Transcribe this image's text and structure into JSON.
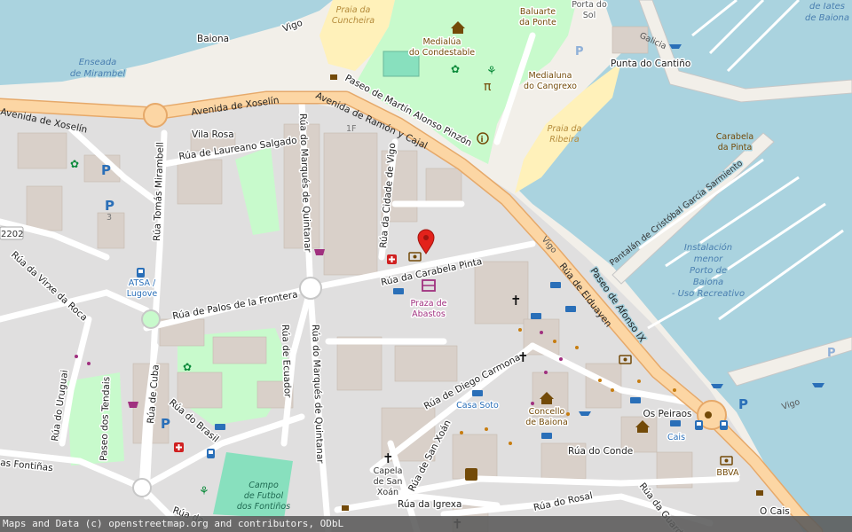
{
  "attribution": "Maps and Data (c) openstreetmap.org and contributors, ODbL",
  "colors": {
    "water": "#aad3df",
    "land": "#f2efe9",
    "residential": "#e0dfdf",
    "park": "#c8facc",
    "pitch": "#88e0be",
    "beach": "#fff1ba",
    "primary_road": "#fcd6a4",
    "primary_casing": "#e6a96a",
    "building": "#d9d0c9",
    "marker": "#e3221b"
  },
  "labels": {
    "baiona_top": "Baiona",
    "vigo_top": "Vigo",
    "enseada": [
      "Enseada",
      "de Mirambel"
    ],
    "praia_cuncheira": [
      "Praia da",
      "Cuncheira"
    ],
    "medialua_condestable": [
      "Medialúa",
      "do Condestable"
    ],
    "baluarte": [
      "Baluarte",
      "da Ponte"
    ],
    "porta_sol": [
      "Porta do",
      "Sol"
    ],
    "iate": [
      "de Iates",
      "de Baiona"
    ],
    "galicia": "Galicia",
    "punta_cantino": "Punta do Cantiño",
    "medialuna_cangrexo": [
      "Medialuna",
      "do Cangrexo"
    ],
    "praia_ribeira": [
      "Praia da",
      "Ribeira"
    ],
    "carabela_pinta_boat": [
      "Carabela",
      "da Pinta"
    ],
    "pantalan": "Pantalán de Cristóbal García Sarmiento",
    "instalacion": [
      "Instalación",
      "menor",
      "Porto de",
      "Baiona",
      "- Uso Recreativo"
    ],
    "avenida_xoselin_left": "Avenida de Xoselín",
    "avenida_xoselin": "Avenida de Xoselín",
    "avenida_ramon": "Avenida de Ramón y Cajal",
    "paseo_martin": "Paseo de Martín Alonso Pinzón",
    "vila_rosa": "Vila Rosa",
    "rua_laureano": "Rúa de Laureano Salgado",
    "rua_tomas": "Rúa Tomás Mirambell",
    "rua_marques_quintanar": "Rúa do Marqués de Quintanar",
    "rua_cidade_vigo": "Rúa da Cidade de Vigo",
    "label_1f": "1F",
    "label_3": "3",
    "road_ref": "2202",
    "rua_virxe": "Rúa da Virxe da Roca",
    "atsa": [
      "ATSA /",
      "Lugove"
    ],
    "rua_palos": "Rúa de Palos de la Frontera",
    "rua_carabela": "Rúa da Carabela Pinta",
    "praza_abastos": [
      "Praza de",
      "Abastos"
    ],
    "vigo_right": "Vigo",
    "rua_elduayen": "Rúa de Elduayen",
    "paseo_afonso": "Paseo de Afonso IX",
    "rua_ecuador": "Rúa de Ecuador",
    "rua_marques_quintanar_2": "Rúa do Marqués de Quintanar",
    "rua_uruguai": "Rúa do Uruguai",
    "paseo_tendais": "Paseo dos Tendais",
    "rua_cuba": "Rúa de Cuba",
    "rua_brasil": "Rúa do Brasil",
    "rua_diego": "Rúa de Diego Carmona",
    "casa_soto": "Casa Soto",
    "concello": [
      "Concello",
      "de Baiona"
    ],
    "os_peiraos": "Os Peiraos",
    "cais": "Cais",
    "vigo_far": "Vigo",
    "rua_fontinas": "as Fontiñas",
    "campo": [
      "Campo",
      "de Futbol",
      "dos Fontiños"
    ],
    "rua_san_xoan": "Rúa de San Xoán",
    "capela": [
      "Capela",
      "de San",
      "Xoán"
    ],
    "rua_conde": "Rúa do Conde",
    "bbva": "BBVA",
    "rua_igrexa": "Rúa da Igrexa",
    "rua_rosal": "Rúa do Rosal",
    "rua_guarda": "Rúa da Guarda",
    "o_cais": "O Cais",
    "rua_bottom": "Rúa da"
  },
  "icons": [
    "marker-icon",
    "pharmacy-icon",
    "bank-icon",
    "parking-icon",
    "bus-stop-icon",
    "playground-icon",
    "picnic-icon",
    "church-icon",
    "hotel-icon",
    "museum-icon",
    "information-icon",
    "town-hall-icon",
    "marketplace-icon",
    "fitness-icon",
    "shop-icon",
    "ferry-icon",
    "cafe-icon",
    "fountain-icon"
  ]
}
